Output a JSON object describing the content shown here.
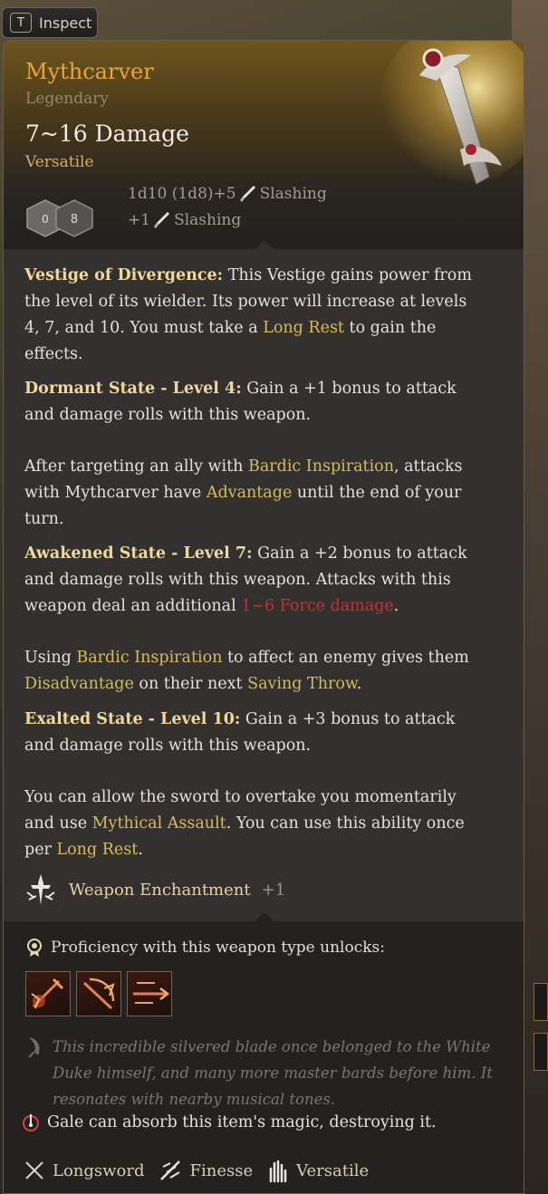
{
  "inspect": {
    "key": "T",
    "label": "Inspect"
  },
  "item": {
    "name": "Mythcarver",
    "rarity": "Legendary",
    "damage": "7~16 Damage",
    "property": "Versatile",
    "dice_faces": [
      "0",
      "8"
    ],
    "damage_lines": [
      {
        "roll": "1d10 (1d8)+5",
        "type": "Slashing"
      },
      {
        "roll": "+1",
        "type": "Slashing"
      }
    ]
  },
  "description": {
    "vestige_title": "Vestige of Divergence:",
    "vestige_text_1": " This Vestige gains power from the level of its wielder. Its power will increase at levels 4, 7, and 10. You must take a ",
    "vestige_link": "Long Rest",
    "vestige_text_2": " to gain the effects.",
    "dormant_title": "Dormant State - Level 4:",
    "dormant_text": " Gain a +1 bonus to attack and damage rolls with this weapon.",
    "after_text_1": "After targeting an ally with ",
    "after_link_1": "Bardic Inspiration",
    "after_text_2": ", attacks with Mythcarver have ",
    "after_link_2": "Advantage",
    "after_text_3": " until the end of your turn.",
    "awakened_title": "Awakened State - Level 7:",
    "awakened_text": " Gain a +2 bonus to attack and damage rolls with this weapon. Attacks with this weapon deal an additional ",
    "awakened_damage": "1~6 Force damage",
    "awakened_end": ".",
    "using_text_1": "Using ",
    "using_link_1": "Bardic Inspiration",
    "using_text_2": " to affect an enemy gives them ",
    "using_link_2": "Disadvantage",
    "using_text_3": " on their next ",
    "using_link_3": "Saving Throw",
    "using_text_4": ".",
    "exalted_title": "Exalted State - Level 10:",
    "exalted_text": " Gain a +3 bonus to attack and damage rolls with this weapon.",
    "allow_text_1": "You can allow the sword to overtake you momentarily and use ",
    "allow_link_1": "Mythical Assault",
    "allow_text_2": ". You can use this ability once per ",
    "allow_link_2": "Long Rest",
    "allow_text_3": "."
  },
  "enchantment": {
    "label": "Weapon Enchantment",
    "value": "+1"
  },
  "proficiency": {
    "label": "Proficiency with this weapon type unlocks:"
  },
  "flavor": "This incredible silvered blade once belonged to the White Duke himself, and many more master bards before him. It resonates with nearby musical tones.",
  "absorb": "Gale can absorb this item's magic, destroying it.",
  "tags": [
    "Longsword",
    "Finesse",
    "Versatile"
  ],
  "colors": {
    "title": "#e7a63a",
    "keyword": "#d6bb5c",
    "damage_red": "#c9302c"
  }
}
